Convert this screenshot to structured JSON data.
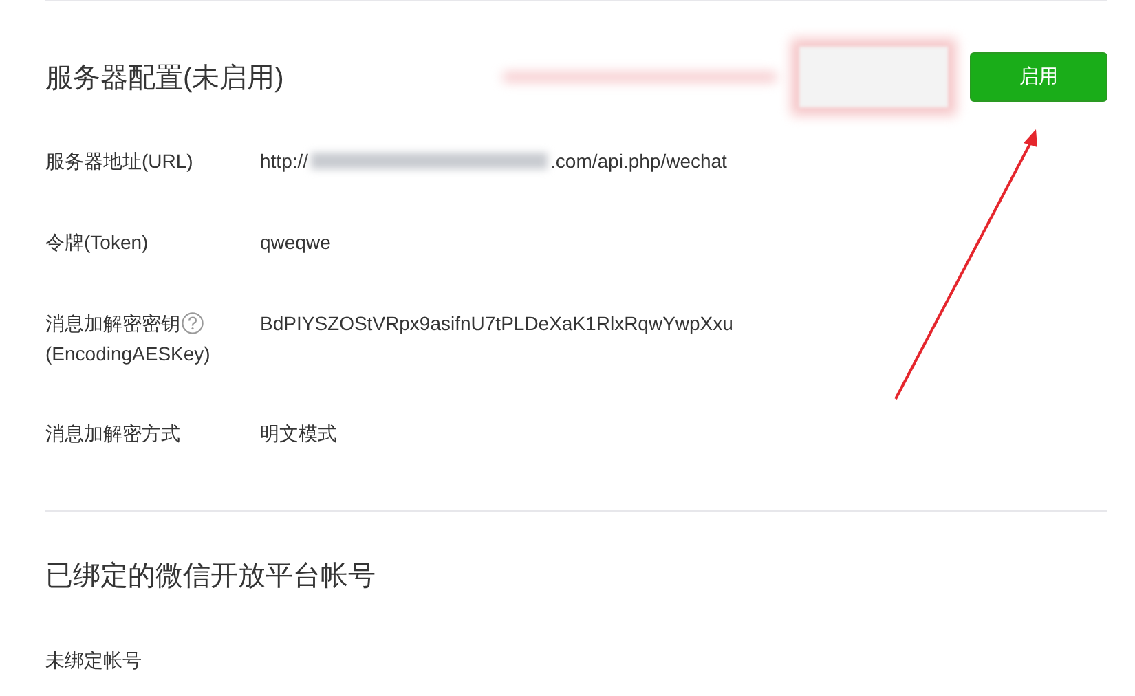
{
  "server_config": {
    "title": "服务器配置(未启用)",
    "enable_button": "启用",
    "fields": [
      {
        "kind": "redacted",
        "label": "服务器地址(URL)",
        "value_before": "http://",
        "value_after": ".com/api.php/wechat",
        "help": false
      },
      {
        "kind": "plain",
        "label": "令牌(Token)",
        "value": "qweqwe",
        "help": false
      },
      {
        "kind": "plain",
        "label": "消息加解密密钥",
        "label_note": "(EncodingAESKey)",
        "value": "BdPIYSZOStVRpx9asifnU7tPLDeXaK1RlxRqwYwpXxu",
        "help": true
      },
      {
        "kind": "plain",
        "label": "消息加解密方式",
        "value": "明文模式",
        "help": false
      }
    ]
  },
  "open_platform": {
    "title": "已绑定的微信开放平台帐号",
    "status": "未绑定帐号"
  }
}
